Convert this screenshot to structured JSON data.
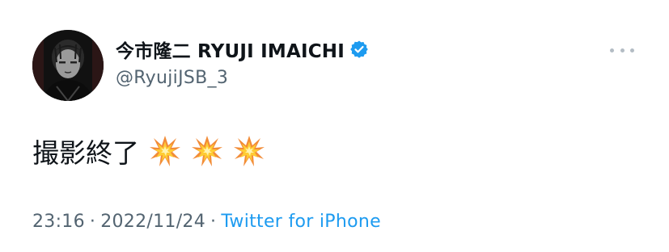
{
  "author": {
    "display_name": "今市隆二 RYUJI IMAICHI",
    "handle": "@RyujiJSB_3",
    "verified": true,
    "verified_icon": "verified-badge-icon",
    "avatar_icon": "profile-photo"
  },
  "tweet": {
    "text": "撮影終了",
    "emoji": [
      "💥",
      "💥",
      "💥"
    ],
    "emoji_icon": "collision-emoji-icon"
  },
  "meta": {
    "time": "23:16",
    "separator_1": "·",
    "date": "2022/11/24",
    "separator_2": "·",
    "source": "Twitter for iPhone"
  },
  "more_menu_icon": "more-options-icon",
  "colors": {
    "text": "#0f1419",
    "secondary": "#536471",
    "link": "#1d9bf0",
    "verified": "#1d9bf0",
    "more_dots": "#b3bcc4"
  }
}
